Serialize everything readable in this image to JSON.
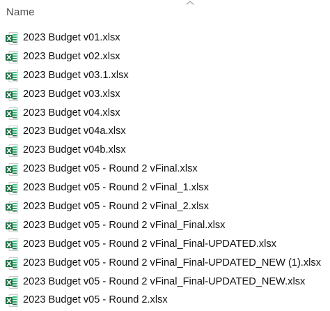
{
  "header": {
    "column_name": "Name",
    "sort_icon": "chevron-up-icon"
  },
  "files": [
    {
      "name": "2023 Budget v01.xlsx",
      "icon": "excel-file-icon"
    },
    {
      "name": "2023 Budget v02.xlsx",
      "icon": "excel-file-icon"
    },
    {
      "name": "2023 Budget v03.1.xlsx",
      "icon": "excel-file-icon"
    },
    {
      "name": "2023 Budget v03.xlsx",
      "icon": "excel-file-icon"
    },
    {
      "name": "2023 Budget v04.xlsx",
      "icon": "excel-file-icon"
    },
    {
      "name": "2023 Budget v04a.xlsx",
      "icon": "excel-file-icon"
    },
    {
      "name": "2023 Budget v04b.xlsx",
      "icon": "excel-file-icon"
    },
    {
      "name": "2023 Budget v05 - Round 2 vFinal.xlsx",
      "icon": "excel-file-icon"
    },
    {
      "name": "2023 Budget v05 - Round 2 vFinal_1.xlsx",
      "icon": "excel-file-icon"
    },
    {
      "name": "2023 Budget v05 - Round 2 vFinal_2.xlsx",
      "icon": "excel-file-icon"
    },
    {
      "name": "2023 Budget v05 - Round 2 vFinal_Final.xlsx",
      "icon": "excel-file-icon"
    },
    {
      "name": "2023 Budget v05 - Round 2 vFinal_Final-UPDATED.xlsx",
      "icon": "excel-file-icon"
    },
    {
      "name": "2023 Budget v05 - Round 2 vFinal_Final-UPDATED_NEW (1).xlsx",
      "icon": "excel-file-icon"
    },
    {
      "name": "2023 Budget v05 - Round 2 vFinal_Final-UPDATED_NEW.xlsx",
      "icon": "excel-file-icon"
    },
    {
      "name": "2023 Budget v05 - Round 2.xlsx",
      "icon": "excel-file-icon"
    }
  ],
  "colors": {
    "excel_green_dark": "#1e6e42",
    "excel_green": "#21a366",
    "excel_green_light": "#33c481",
    "page_border": "#c8c8c8"
  }
}
